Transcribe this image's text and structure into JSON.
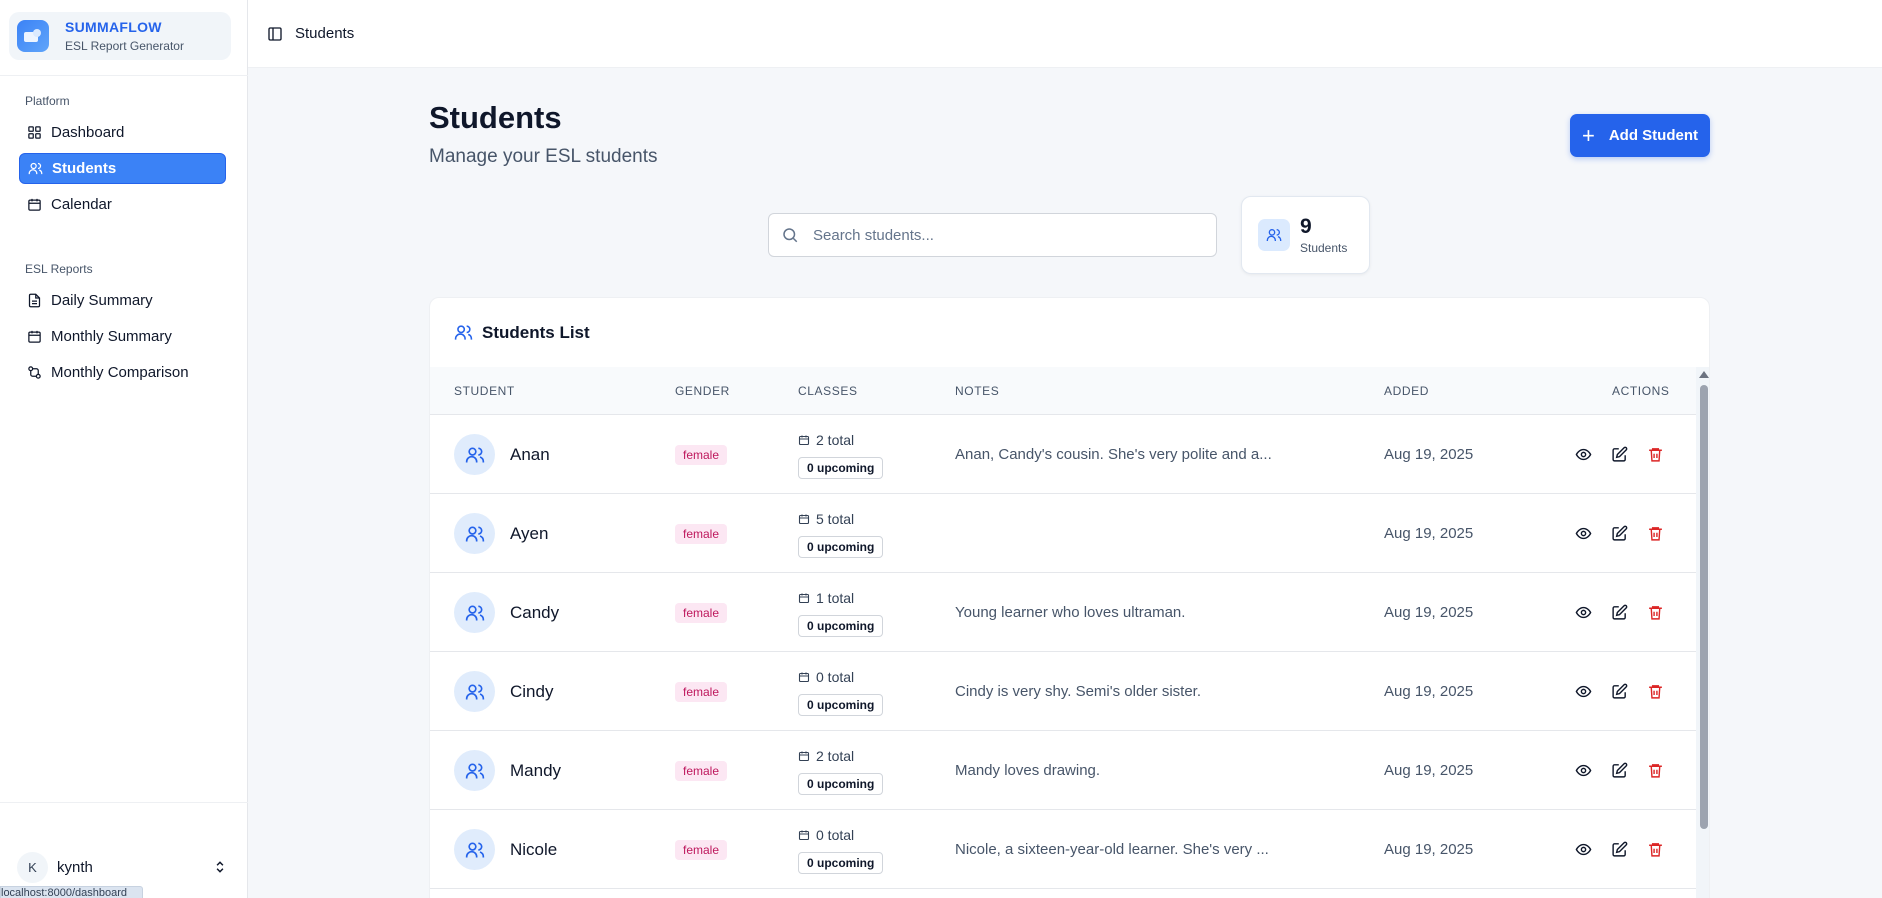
{
  "brand": {
    "title": "SUMMAFLOW",
    "subtitle": "ESL Report Generator"
  },
  "sidebar": {
    "sections": [
      {
        "label": "Platform",
        "items": [
          {
            "label": "Dashboard",
            "icon": "grid-icon"
          },
          {
            "label": "Students",
            "icon": "users-icon",
            "active": true
          },
          {
            "label": "Calendar",
            "icon": "calendar-icon"
          }
        ]
      },
      {
        "label": "ESL Reports",
        "items": [
          {
            "label": "Daily Summary",
            "icon": "file-text-icon"
          },
          {
            "label": "Monthly Summary",
            "icon": "calendar-icon"
          },
          {
            "label": "Monthly Comparison",
            "icon": "compare-icon"
          }
        ]
      }
    ],
    "user": {
      "initial": "K",
      "name": "kynth"
    }
  },
  "status_url": "localhost:8000/dashboard",
  "topbar": {
    "breadcrumb": "Students"
  },
  "page": {
    "title": "Students",
    "subtitle": "Manage your ESL students",
    "add_button": "Add Student",
    "search_placeholder": "Search students...",
    "count": {
      "value": "9",
      "label": "Students"
    }
  },
  "list": {
    "title": "Students List",
    "columns": {
      "student": "STUDENT",
      "gender": "GENDER",
      "classes": "CLASSES",
      "notes": "NOTES",
      "added": "ADDED",
      "actions": "ACTIONS"
    },
    "rows": [
      {
        "name": "Anan",
        "gender": "female",
        "total": "2 total",
        "upcoming": "0 upcoming",
        "notes": "Anan, Candy's cousin. She's very polite and a...",
        "added": "Aug 19, 2025"
      },
      {
        "name": "Ayen",
        "gender": "female",
        "total": "5 total",
        "upcoming": "0 upcoming",
        "notes": "",
        "added": "Aug 19, 2025"
      },
      {
        "name": "Candy",
        "gender": "female",
        "total": "1 total",
        "upcoming": "0 upcoming",
        "notes": "Young learner who loves ultraman.",
        "added": "Aug 19, 2025"
      },
      {
        "name": "Cindy",
        "gender": "female",
        "total": "0 total",
        "upcoming": "0 upcoming",
        "notes": "Cindy is very shy. Semi's older sister.",
        "added": "Aug 19, 2025"
      },
      {
        "name": "Mandy",
        "gender": "female",
        "total": "2 total",
        "upcoming": "0 upcoming",
        "notes": "Mandy loves drawing.",
        "added": "Aug 19, 2025"
      },
      {
        "name": "Nicole",
        "gender": "female",
        "total": "0 total",
        "upcoming": "0 upcoming",
        "notes": "Nicole, a sixteen-year-old learner. She's very ...",
        "added": "Aug 19, 2025"
      }
    ]
  },
  "colors": {
    "accent": "#2563eb",
    "active_nav": "#3b82f6",
    "delete": "#dc2626",
    "gender_badge": "#fce7f3"
  }
}
